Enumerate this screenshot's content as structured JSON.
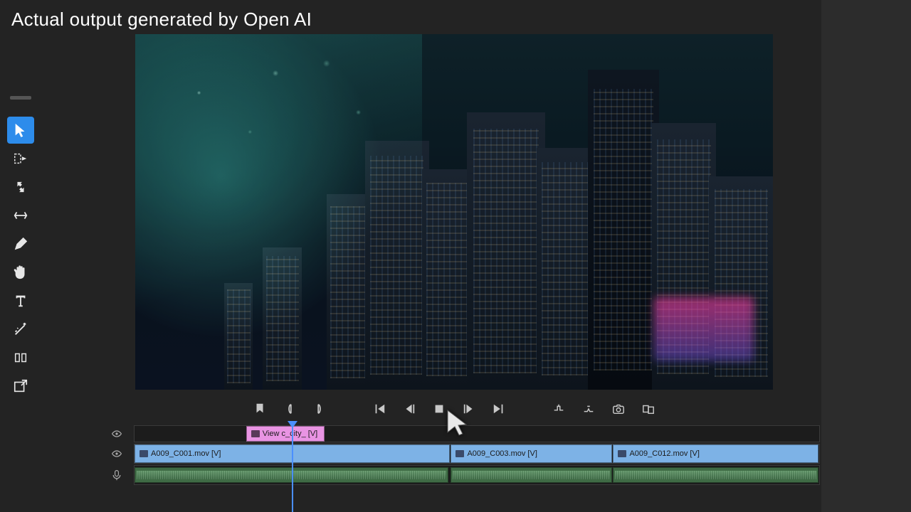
{
  "overlay": {
    "text": "Actual output generated by Open AI"
  },
  "tools": [
    {
      "name": "selection-tool",
      "active": true
    },
    {
      "name": "track-select-forward-tool",
      "active": false
    },
    {
      "name": "ripple-edit-tool",
      "active": false
    },
    {
      "name": "rate-stretch-tool",
      "active": false
    },
    {
      "name": "pen-tool",
      "active": false
    },
    {
      "name": "hand-tool",
      "active": false
    },
    {
      "name": "type-tool",
      "active": false
    },
    {
      "name": "remix-tool",
      "active": false
    },
    {
      "name": "edit-tool",
      "active": false
    },
    {
      "name": "export-frame-tool",
      "active": false
    }
  ],
  "transport": {
    "buttons": [
      "add-marker",
      "mark-in",
      "mark-out",
      "go-to-in",
      "step-back",
      "play-toggle",
      "step-forward",
      "go-to-out",
      "lift",
      "extract",
      "snapshot",
      "comparison-view"
    ]
  },
  "timeline": {
    "tracks": {
      "v2": {
        "clips": [
          {
            "label": "View c_city_ [V]",
            "left_pct": 16.3,
            "width_pct": 11.5
          }
        ]
      },
      "v1": {
        "clips": [
          {
            "label": "A009_C001.mov [V]",
            "left_pct": 0,
            "width_pct": 46
          },
          {
            "label": "A009_C003.mov [V]",
            "left_pct": 46.2,
            "width_pct": 23.5
          },
          {
            "label": "A009_C012.mov [V]",
            "left_pct": 69.9,
            "width_pct": 30
          }
        ]
      },
      "a1": {
        "clips": [
          {
            "left_pct": 0,
            "width_pct": 45.8
          },
          {
            "left_pct": 46.2,
            "width_pct": 23.5
          },
          {
            "left_pct": 69.9,
            "width_pct": 30
          }
        ]
      }
    }
  },
  "colors": {
    "accent": "#2d8ceb",
    "clip_video": "#7db2e6",
    "clip_title": "#e994e3",
    "clip_audio": "#3f6b45",
    "playhead": "#4a8fff"
  }
}
